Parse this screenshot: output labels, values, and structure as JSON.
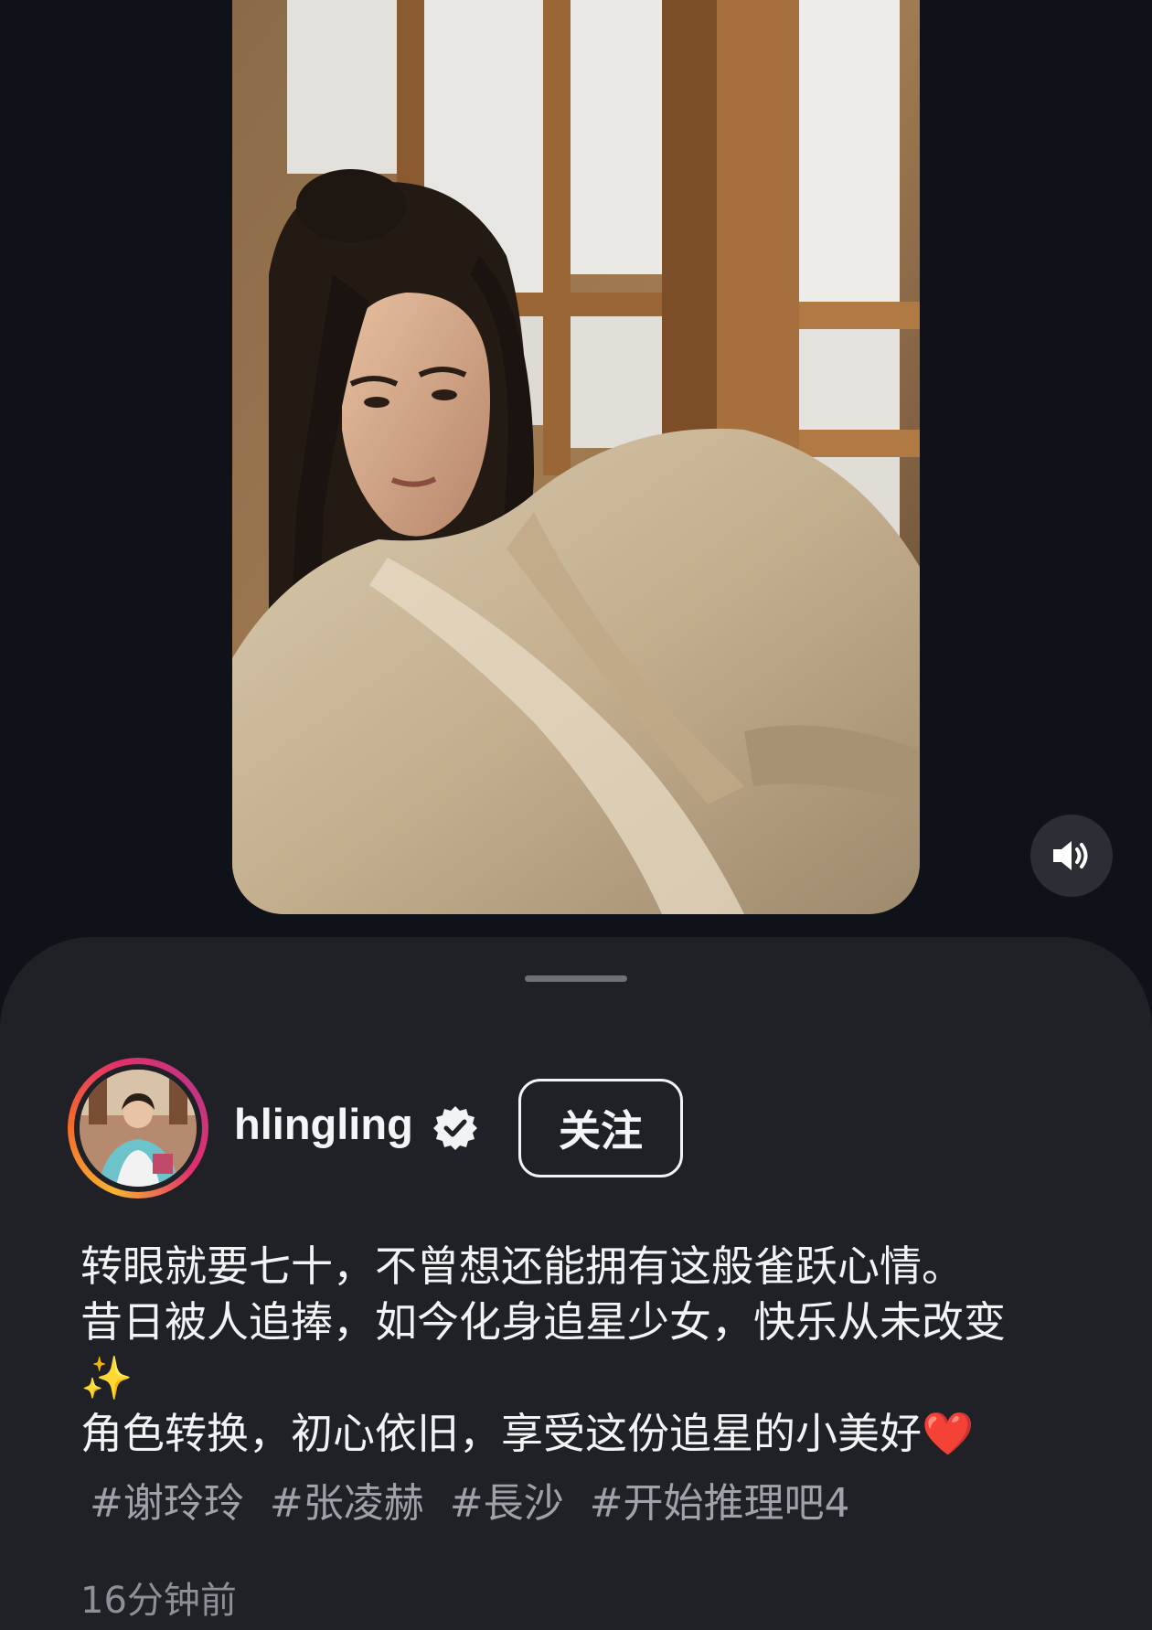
{
  "post": {
    "username": "hlingling",
    "verified": true,
    "follow_label": "关注",
    "caption_lines": [
      "转眼就要七十，不曾想还能拥有这般雀跃心情。",
      "昔日被人追捧，如今化身追星少女，快乐从未改变",
      "✨",
      "角色转换，初心依旧，享受这份追星的小美好❤️"
    ],
    "hashtags": [
      "#谢玲玲",
      "#张凌赫",
      "#長沙",
      "#开始推理吧4"
    ],
    "timestamp": "16分钟前"
  },
  "icons": {
    "volume": "speaker-volume-icon",
    "verified": "verified-badge-icon"
  },
  "colors": {
    "background": "#0f1218",
    "sheet": "#1f2127",
    "text": "#f2f3f5",
    "muted": "#9fa2a9"
  }
}
